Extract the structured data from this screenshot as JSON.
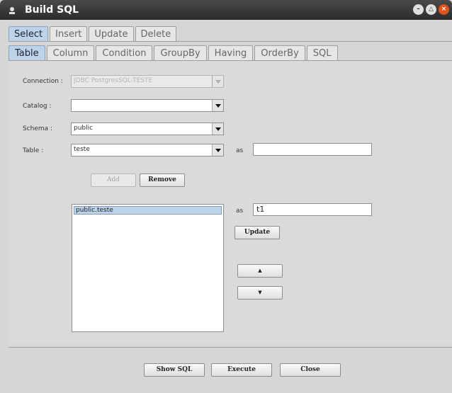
{
  "window": {
    "title": "Build SQL"
  },
  "outer_tabs": [
    "Select",
    "Insert",
    "Update",
    "Delete"
  ],
  "inner_tabs": [
    "Table",
    "Column",
    "Condition",
    "GroupBy",
    "Having",
    "OrderBy",
    "SQL"
  ],
  "form": {
    "connection_label": "Connection :",
    "connection_value": "JDBC PostgresSQL-TESTE",
    "catalog_label": "Catalog :",
    "catalog_value": "",
    "schema_label": "Schema :",
    "schema_value": "public",
    "table_label": "Table :",
    "table_value": "teste",
    "as_label": "as",
    "alias_value": ""
  },
  "buttons": {
    "add": "Add",
    "remove": "Remove",
    "update": "Update"
  },
  "selected_tables": [
    "public.teste"
  ],
  "selected_alias": {
    "as_label": "as",
    "value": "t1"
  },
  "footer": {
    "show_sql": "Show SQL",
    "execute": "Execute",
    "close": "Close"
  },
  "colors": {
    "title_bar": "#2f2f2f",
    "tab_active": "#bcd3ea",
    "close_button": "#e0531f"
  },
  "icons": {
    "app": "user-icon",
    "move_up": "arrow-up-icon",
    "move_down": "arrow-down-icon"
  }
}
